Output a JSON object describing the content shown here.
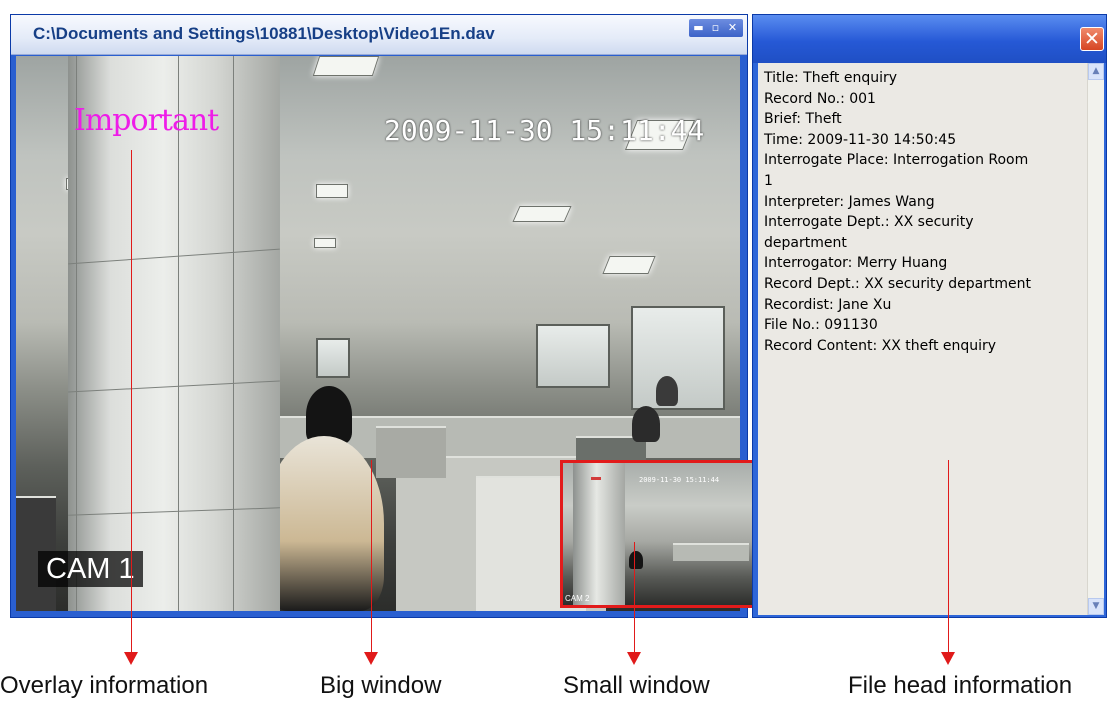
{
  "video_window": {
    "title": "C:\\Documents and Settings\\10881\\Desktop\\Video1En.dav",
    "controls": {
      "minimize": "▬",
      "maximize": "▫",
      "close": "✕"
    },
    "overlay_text": "Important",
    "timestamp": "2009-11-30 15:11:44",
    "camera_label": "CAM 1"
  },
  "small_window": {
    "timestamp": "2009-11-30 15:11:44",
    "camera_label": "CAM 2"
  },
  "info_panel": {
    "close": "✕",
    "lines": [
      "Title:  Theft enquiry",
      "Record No.:  001",
      "Brief:  Theft",
      "Time:  2009-11-30  14:50:45",
      "Interrogate Place:  Interrogation Room",
      "1",
      "Interpreter:  James Wang",
      "Interrogate Dept.:  XX security",
      "department",
      "Interrogator:  Merry Huang",
      "Record Dept.:  XX security department",
      "Recordist:  Jane Xu",
      "File No.:  091130",
      "Record Content:  XX theft enquiry"
    ],
    "scroll_up": "▲",
    "scroll_down": "▼"
  },
  "callouts": {
    "overlay": "Overlay information",
    "big": "Big window",
    "small": "Small window",
    "file_head": "File head information"
  },
  "colors": {
    "callout_red": "#e01a1a",
    "overlay_magenta": "#ee1ce8",
    "title_blue": "#163f86"
  }
}
